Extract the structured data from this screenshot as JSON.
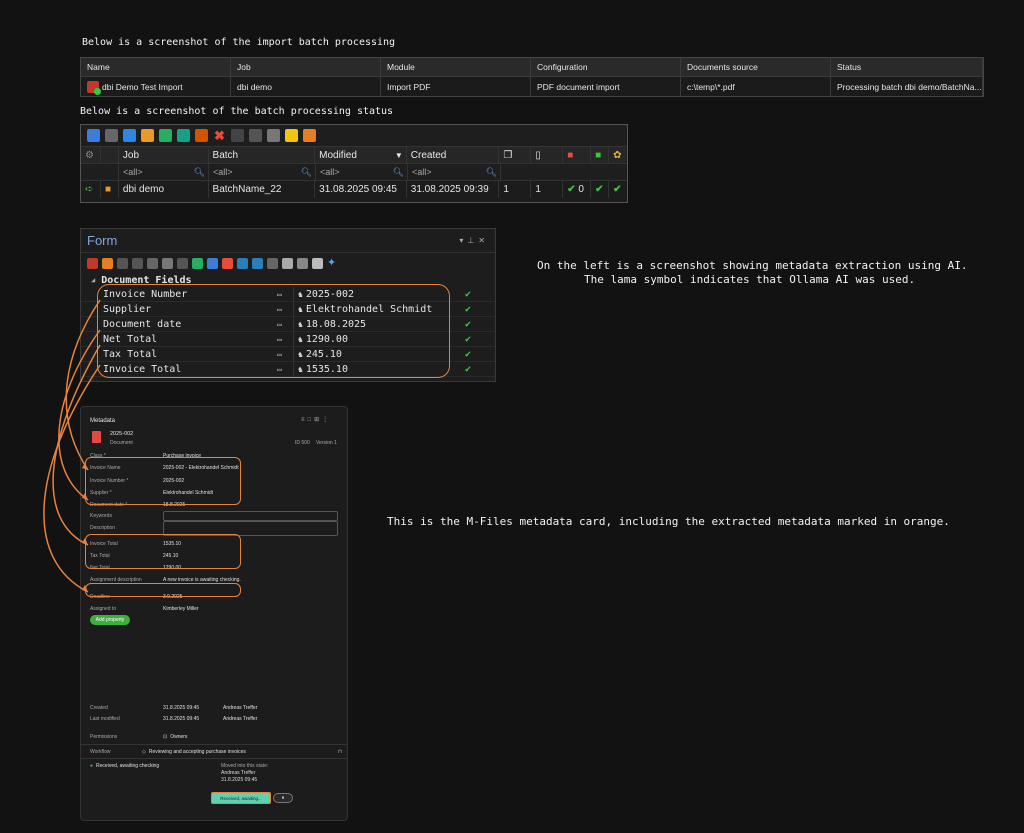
{
  "captions": {
    "import": "Below is a screenshot of the import batch processing",
    "batch": "Below is a screenshot of the batch processing status",
    "ai_line1": "On the left is a screenshot showing metadata extraction using AI.",
    "ai_line2": "The lama symbol indicates that Ollama AI was used.",
    "mfiles": "This is the M-Files metadata card, including the extracted metadata marked in orange."
  },
  "import_grid": {
    "headers": [
      "Name",
      "Job",
      "Module",
      "Configuration",
      "Documents source",
      "Status"
    ],
    "row": [
      "dbi Demo Test Import",
      "dbi demo",
      "Import PDF",
      "PDF document import",
      "c:\\temp\\*.pdf",
      "Processing batch dbi demo/BatchNa..."
    ]
  },
  "batch_grid": {
    "headers": [
      "Job",
      "Batch",
      "Modified",
      "Created"
    ],
    "filters": [
      "<all>",
      "<all>",
      "<all>",
      "<all>"
    ],
    "row": {
      "job": "dbi demo",
      "batch": "BatchName_22",
      "modified": "31.08.2025 09:45",
      "created": "31.08.2025 09:39",
      "n1": "1",
      "n2": "1",
      "n3": "0"
    }
  },
  "form": {
    "title": "Form",
    "section": "Document Fields",
    "fields": [
      {
        "label": "Invoice Number",
        "value": "2025-002"
      },
      {
        "label": "Supplier",
        "value": "Elektrohandel Schmidt"
      },
      {
        "label": "Document date",
        "value": "18.08.2025"
      },
      {
        "label": "Net Total",
        "value": "1290.00"
      },
      {
        "label": "Tax Total",
        "value": "245.10"
      },
      {
        "label": "Invoice Total",
        "value": "1535.10"
      }
    ]
  },
  "card": {
    "title": "Metadata",
    "doc_name": "2025-002",
    "doc_type": "Document",
    "id_label": "ID 500",
    "version": "Version 1",
    "rows": [
      {
        "k": "Class *",
        "v": "Purchase invoice"
      },
      {
        "k": "Invoice Name",
        "v": "2025-002 - Elektrohandel Schmidt"
      },
      {
        "k": "Invoice Number *",
        "v": "2025-002"
      },
      {
        "k": "Supplier *",
        "v": "Elektrohandel Schmidt"
      },
      {
        "k": "Document date *",
        "v": "18.8.2025"
      },
      {
        "k": "Keywords",
        "v": ""
      },
      {
        "k": "Description",
        "v": ""
      },
      {
        "k": "Invoice Total",
        "v": "1535.10"
      },
      {
        "k": "Tax Total",
        "v": "245.10"
      },
      {
        "k": "Net Total",
        "v": "1290.00"
      },
      {
        "k": "Assignment description",
        "v": "A new invoice is awaiting checking."
      },
      {
        "k": "Deadline",
        "v": "3.9.2025"
      },
      {
        "k": "Assigned to",
        "v": "Kimberley Miller"
      }
    ],
    "add_property": "Add property",
    "created": {
      "k": "Created",
      "date": "31.8.2025 09:45",
      "user": "Andreas Treffer"
    },
    "modified": {
      "k": "Last modified",
      "date": "31.8.2025 09:45",
      "user": "Andreas Treffer"
    },
    "permissions": {
      "k": "Permissions",
      "v": "Owners"
    },
    "workflow": {
      "k": "Workflow",
      "v": "Reviewing and accepting purchase invoices"
    },
    "state": "Received, awaiting checking",
    "moved_label": "Moved into this state:",
    "moved_user": "Andreas Treffer",
    "moved_date": "31.8.2025 09:45",
    "state_btn": "Received, awaiting..."
  }
}
